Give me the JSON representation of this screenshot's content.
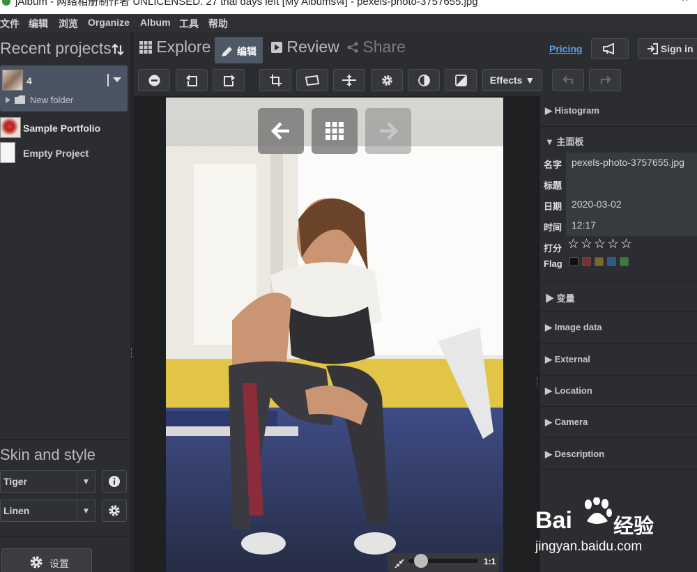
{
  "window": {
    "title": "jAlbum - 网络相册制作者 UNLICENSED. 27 trial days left [My Albums\\4] - pexels-photo-3757655.jpg",
    "minimize": "–",
    "close": "×"
  },
  "menu": [
    "文件",
    "编辑",
    "浏览",
    "Organize",
    "Album",
    "工具",
    "帮助"
  ],
  "sidebar": {
    "heading": "Recent projects",
    "sort_icon": "sort-arrows-icon",
    "projects": [
      {
        "name": "4",
        "selected": true,
        "sub": "New folder"
      },
      {
        "name": "Sample Portfolio",
        "selected": false
      },
      {
        "name": "Empty Project",
        "selected": false
      }
    ],
    "skin_heading": "Skin and style",
    "skin": "Tiger",
    "style": "Linen",
    "settings_button": "设置"
  },
  "modes": {
    "explore": "Explore",
    "edit": "编辑",
    "review": "Review",
    "share": "Share",
    "pricing": "Pricing",
    "sign_in": "Sign in"
  },
  "toolbar": {
    "effects": "Effects ▼"
  },
  "viewer": {
    "zoom_label": "1:1"
  },
  "panel": {
    "histogram": "Histogram",
    "main_panel": "主面板",
    "fields": {
      "name_label": "名字",
      "name_value": "pexels-photo-3757655.jpg",
      "title_label": "标题",
      "title_value": "",
      "date_label": "日期",
      "date_value": "2020-03-02",
      "time_label": "时间",
      "time_value": "12:17",
      "rating_label": "打分",
      "rating_value": 0,
      "flag_label": "Flag"
    },
    "flag_colors": [
      "#111111",
      "#7a2e2e",
      "#7a6a2a",
      "#2d5a8a",
      "#3a7a3a"
    ],
    "sections": [
      "变量",
      "Image data",
      "External",
      "Location",
      "Camera",
      "Description"
    ]
  },
  "colors": {
    "accent_link": "#5aa2f0",
    "active_mode_bg": "#4f5865",
    "selected_project_bg": "#4b5462"
  },
  "watermark": {
    "brand": "Bai",
    "brand_suffix": "经验",
    "url": "jingyan.baidu.com"
  }
}
